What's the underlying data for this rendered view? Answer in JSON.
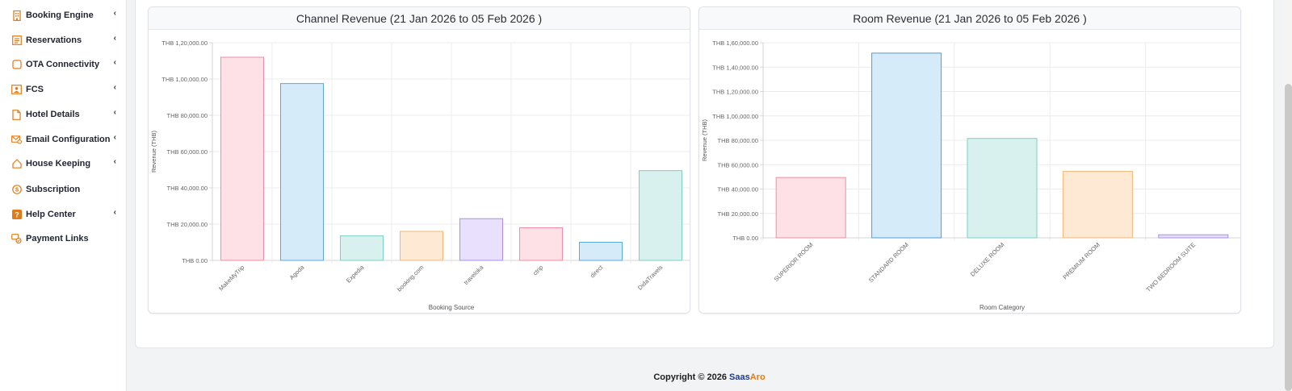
{
  "sidebar": {
    "items": [
      {
        "label": "Booking Engine",
        "icon": "building-icon",
        "chevron": "‹"
      },
      {
        "label": "Reservations",
        "icon": "list-icon",
        "chevron": "‹"
      },
      {
        "label": "OTA Connectivity",
        "icon": "square-icon",
        "chevron": "‹"
      },
      {
        "label": "FCS",
        "icon": "id-card-icon",
        "chevron": "‹"
      },
      {
        "label": "Hotel Details",
        "icon": "document-icon",
        "chevron": "‹"
      },
      {
        "label": "Email Configuration",
        "icon": "email-gear-icon",
        "chevron": "‹"
      },
      {
        "label": "House Keeping",
        "icon": "home-icon",
        "chevron": "‹"
      },
      {
        "label": "Subscription",
        "icon": "dollar-circle-icon",
        "chevron": ""
      },
      {
        "label": "Help Center",
        "icon": "help-icon",
        "chevron": "‹"
      },
      {
        "label": "Payment Links",
        "icon": "link-icon",
        "chevron": ""
      }
    ],
    "icon_color": "#e07b1a"
  },
  "chart_data": [
    {
      "type": "bar",
      "title": "Channel Revenue (21 Jan 2026 to 05 Feb 2026 )",
      "xlabel": "Booking Source",
      "ylabel": "Revenue (THB)",
      "ylim": [
        0,
        120000
      ],
      "yticks": [
        "THB 0.00",
        "THB 20,000.00",
        "THB 40,000.00",
        "THB 60,000.00",
        "THB 80,000.00",
        "THB 1,00,000.00",
        "THB 1,20,000.00"
      ],
      "categories": [
        "MakeMyTrip",
        "Agoda",
        "Expedia",
        "booking.com",
        "traveloka",
        "ctrip",
        "direct",
        "DidaTravels"
      ],
      "values": [
        112000,
        97500,
        13500,
        16000,
        23000,
        18000,
        10000,
        49500
      ],
      "grid": true,
      "colors": {
        "fill": [
          "#fde1e7",
          "#d6ebfa",
          "#d8f1ef",
          "#fde9d4",
          "#e8e0fc",
          "#fde1e7",
          "#d6ebfa",
          "#d8f1ef"
        ],
        "stroke": [
          "#f08ea4",
          "#5aa9df",
          "#7ccfc7",
          "#f5b877",
          "#a98ef0",
          "#f08ea4",
          "#5aa9df",
          "#7ccfc7"
        ]
      }
    },
    {
      "type": "bar",
      "title": "Room Revenue (21 Jan 2026 to 05 Feb 2026 )",
      "xlabel": "Room Category",
      "ylabel": "Revenue (THB)",
      "ylim": [
        0,
        160000
      ],
      "yticks": [
        "THB 0.00",
        "THB 20,000.00",
        "THB 40,000.00",
        "THB 60,000.00",
        "THB 80,000.00",
        "THB 1,00,000.00",
        "THB 1,20,000.00",
        "THB 1,40,000.00",
        "THB 1,60,000.00"
      ],
      "categories": [
        "SUPERIOR ROOM",
        "STANDARD ROOM",
        "DELUXE ROOM",
        "PREMIUM ROOM",
        "TWO BEDROOM SUITE"
      ],
      "values": [
        49500,
        151500,
        81500,
        54500,
        2500
      ],
      "grid": true,
      "colors": {
        "fill": [
          "#fde1e7",
          "#d6ebfa",
          "#d8f1ef",
          "#fde9d4",
          "#e8e0fc"
        ],
        "stroke": [
          "#f08ea4",
          "#4a9fd8",
          "#7ccfc7",
          "#f5b877",
          "#a98ef0"
        ]
      }
    }
  ],
  "footer": {
    "copyright": "Copyright © 2026 ",
    "brand_part1": "Saas",
    "brand_part2": "Aro"
  }
}
